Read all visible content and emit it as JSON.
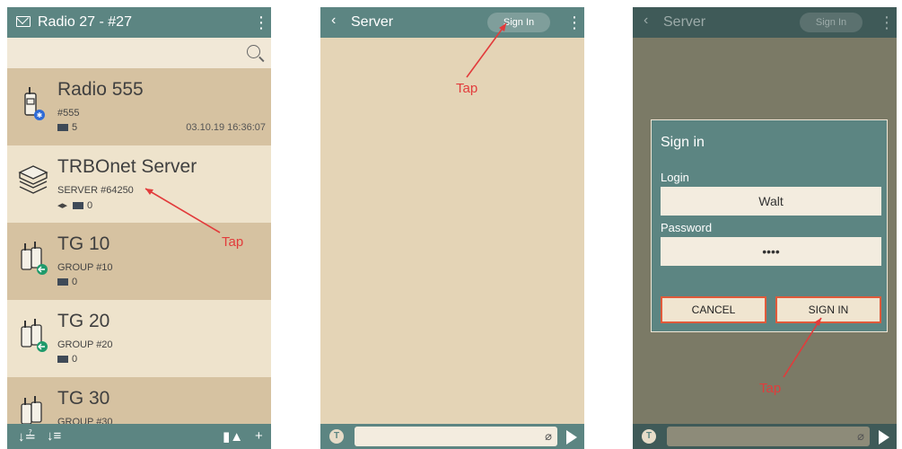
{
  "screen1": {
    "title": "Radio 27 - #27",
    "rows": [
      {
        "name": "Radio 555",
        "sub": "#555",
        "count": "5",
        "timestamp": "03.10.19 16:36:07"
      },
      {
        "name": "TRBOnet Server",
        "sub": "SERVER #64250",
        "count": "0"
      },
      {
        "name": "TG 10",
        "sub": "GROUP #10",
        "count": "0"
      },
      {
        "name": "TG 20",
        "sub": "GROUP #20",
        "count": "0"
      },
      {
        "name": "TG 30",
        "sub": "GROUP #30"
      }
    ],
    "tap": "Tap"
  },
  "screen2": {
    "title": "Server",
    "signin": "Sign In",
    "tap": "Tap"
  },
  "screen3": {
    "title": "Server",
    "signin": "Sign In",
    "dialog": {
      "title": "Sign in",
      "login_label": "Login",
      "login_value": "Walt",
      "password_label": "Password",
      "password_value": "••••",
      "cancel": "CANCEL",
      "submit": "SIGN IN"
    },
    "tap": "Tap"
  },
  "colors": {
    "toolbar": "#5c8582",
    "arrow": "#e23b3b"
  }
}
